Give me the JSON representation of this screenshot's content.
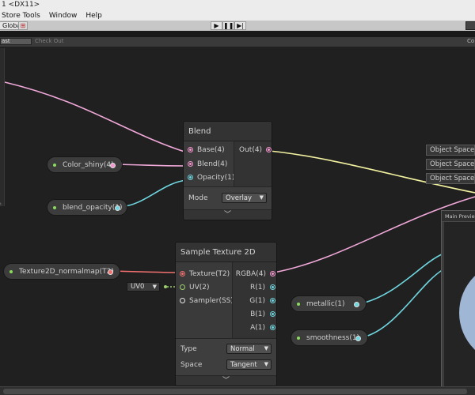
{
  "window": {
    "title": "1 <DX11>"
  },
  "menu": [
    "Store Tools",
    "Window",
    "Help"
  ],
  "toolbar": {
    "scope_label": "Global",
    "play_icons": [
      "play-icon",
      "pause-icon",
      "step-icon"
    ]
  },
  "graph_toolbar": {
    "save_label": "ast",
    "checkout_label": "Check Out",
    "right_label": "Co"
  },
  "left_panel": {
    "tag": "t."
  },
  "properties": {
    "color_shiny": "Color_shiny(4)",
    "blend_opacity": "blend_opacity(1)",
    "normalmap": "Texture2D_normalmap(T2)",
    "metallic": "metallic(1)",
    "smoothness": "smoothness(1)"
  },
  "blend_node": {
    "title": "Blend",
    "inputs": [
      "Base(4)",
      "Blend(4)",
      "Opacity(1)"
    ],
    "output": "Out(4)",
    "mode_label": "Mode",
    "mode_value": "Overlay"
  },
  "sample_node": {
    "title": "Sample Texture 2D",
    "inputs": [
      "Texture(T2)",
      "UV(2)",
      "Sampler(SS)"
    ],
    "outputs": [
      "RGBA(4)",
      "R(1)",
      "G(1)",
      "B(1)",
      "A(1)"
    ],
    "type_label": "Type",
    "type_value": "Normal",
    "space_label": "Space",
    "space_value": "Tangent"
  },
  "uv_dropdown": "UV0",
  "object_space": [
    "Object Space",
    "Object Space",
    "Object Space"
  ],
  "preview": {
    "title": "Main Preview"
  },
  "colors": {
    "pink_wire": "#f0a8d8",
    "cyan_wire": "#6fd6e0",
    "yellow_wire": "#f2f2a0",
    "red_wire": "#f07070",
    "green_wire": "#9ed26d"
  }
}
